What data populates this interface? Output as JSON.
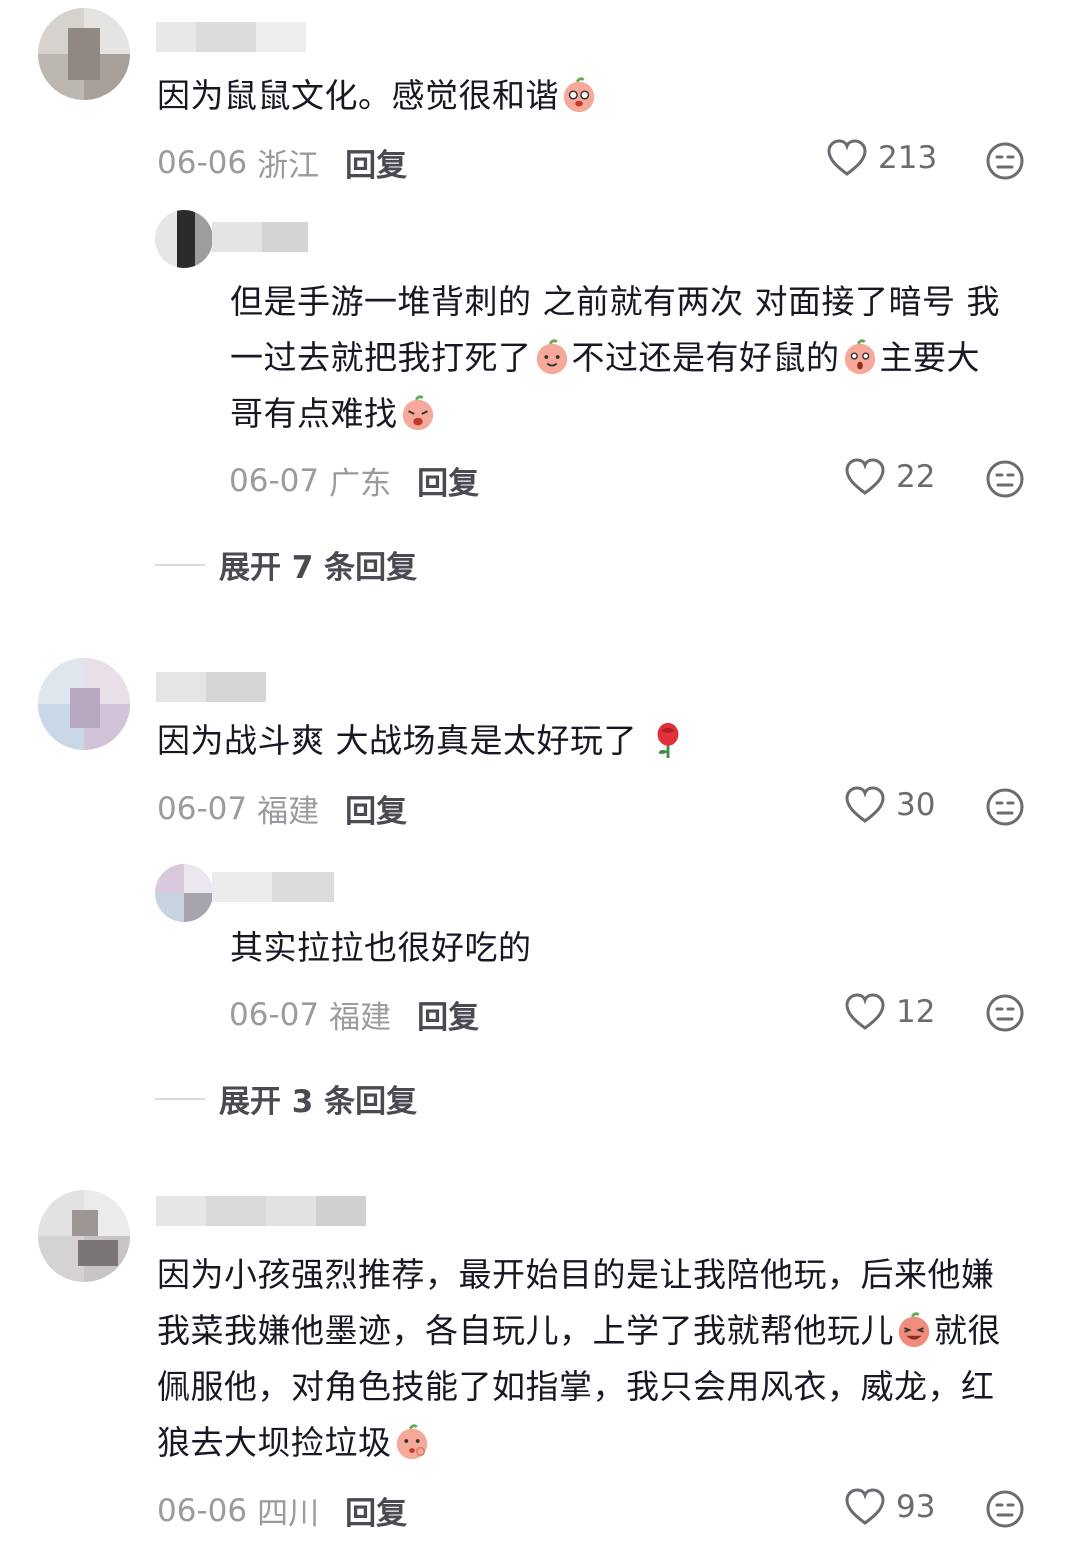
{
  "comments": [
    {
      "text": "因为鼠鼠文化。感觉很和谐",
      "emoji": "peach-cry-emoji",
      "date": "06-06",
      "location": "浙江",
      "reply_label": "回复",
      "likes": "213",
      "reply": {
        "text_1": "但是手游一堆背刺的 之前就有两次 对面接了暗号 我",
        "text_2": "一过去就把我打死了",
        "text_3": "不过还是有好鼠的",
        "text_4": "主要大",
        "text_5": "哥有点难找",
        "date": "06-07",
        "location": "广东",
        "reply_label": "回复",
        "likes": "22"
      },
      "expand_label": "展开 7 条回复"
    },
    {
      "text": "因为战斗爽 大战场真是太好玩了",
      "emoji": "rose-emoji",
      "date": "06-07",
      "location": "福建",
      "reply_label": "回复",
      "likes": "30",
      "reply": {
        "text": "其实拉拉也很好吃的",
        "date": "06-07",
        "location": "福建",
        "reply_label": "回复",
        "likes": "12"
      },
      "expand_label": "展开 3 条回复"
    },
    {
      "line_1": "因为小孩强烈推荐，最开始目的是让我陪他玩，后来他嫌",
      "line_2a": "我菜我嫌他墨迹，各自玩儿，上学了我就帮他玩儿",
      "line_2b": "就很",
      "line_3": "佩服他，对角色技能了如指掌，我只会用风衣，威龙，红",
      "line_4": "狼去大坝捡垃圾",
      "date": "06-06",
      "location": "四川",
      "reply_label": "回复",
      "likes": "93"
    }
  ],
  "colors": {
    "text": "#161823",
    "meta": "#9a9ba0",
    "icon": "#6b6c72"
  }
}
